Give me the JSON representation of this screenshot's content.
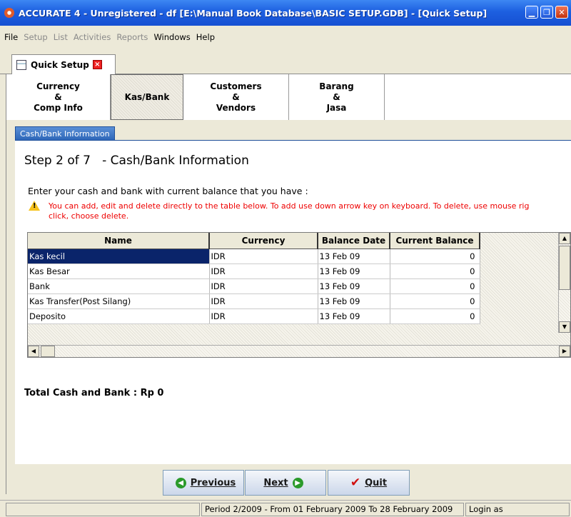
{
  "window": {
    "title": "ACCURATE 4 - Unregistered - df  [E:\\Manual Book Database\\BASIC SETUP.GDB] - [Quick Setup]"
  },
  "menu": {
    "items": [
      {
        "label": "File",
        "enabled": true
      },
      {
        "label": "Setup",
        "enabled": false
      },
      {
        "label": "List",
        "enabled": false
      },
      {
        "label": "Activities",
        "enabled": false
      },
      {
        "label": "Reports",
        "enabled": false
      },
      {
        "label": "Windows",
        "enabled": true
      },
      {
        "label": "Help",
        "enabled": true
      }
    ]
  },
  "doc_tab": {
    "label": "Quick Setup",
    "close": "×"
  },
  "steps": [
    {
      "label": "Currency\n&\nComp Info",
      "active": false
    },
    {
      "label": "Kas/Bank",
      "active": true
    },
    {
      "label": "Customers\n&\nVendors",
      "active": false
    },
    {
      "label": "Barang\n&\nJasa",
      "active": false
    }
  ],
  "section_tab": "Cash/Bank Information",
  "step_title": "Step 2 of 7   - Cash/Bank Information",
  "instruction": "Enter your cash and bank with current balance that you have :",
  "warning": {
    "line1": "You can add, edit and delete directly to the table below. To add use down arrow key on keyboard. To delete, use mouse rig",
    "line2": "click, choose delete."
  },
  "grid": {
    "columns": [
      "Name",
      "Currency",
      "Balance Date",
      "Current Balance"
    ],
    "rows": [
      {
        "name": "Kas kecil",
        "currency": "IDR",
        "date": "13 Feb 09",
        "balance": "0"
      },
      {
        "name": "Kas Besar",
        "currency": "IDR",
        "date": "13 Feb 09",
        "balance": "0"
      },
      {
        "name": "Bank",
        "currency": "IDR",
        "date": "13 Feb 09",
        "balance": "0"
      },
      {
        "name": "Kas Transfer(Post Silang)",
        "currency": "IDR",
        "date": "13 Feb 09",
        "balance": "0"
      },
      {
        "name": "Deposito",
        "currency": "IDR",
        "date": "13 Feb 09",
        "balance": "0"
      }
    ]
  },
  "total": "Total Cash and Bank : Rp 0",
  "buttons": {
    "previous": "Previous",
    "next": "Next",
    "quit": "Quit"
  },
  "status": {
    "period": "Period 2/2009 - From 01 February 2009 To 28 February 2009",
    "login": "Login as"
  }
}
